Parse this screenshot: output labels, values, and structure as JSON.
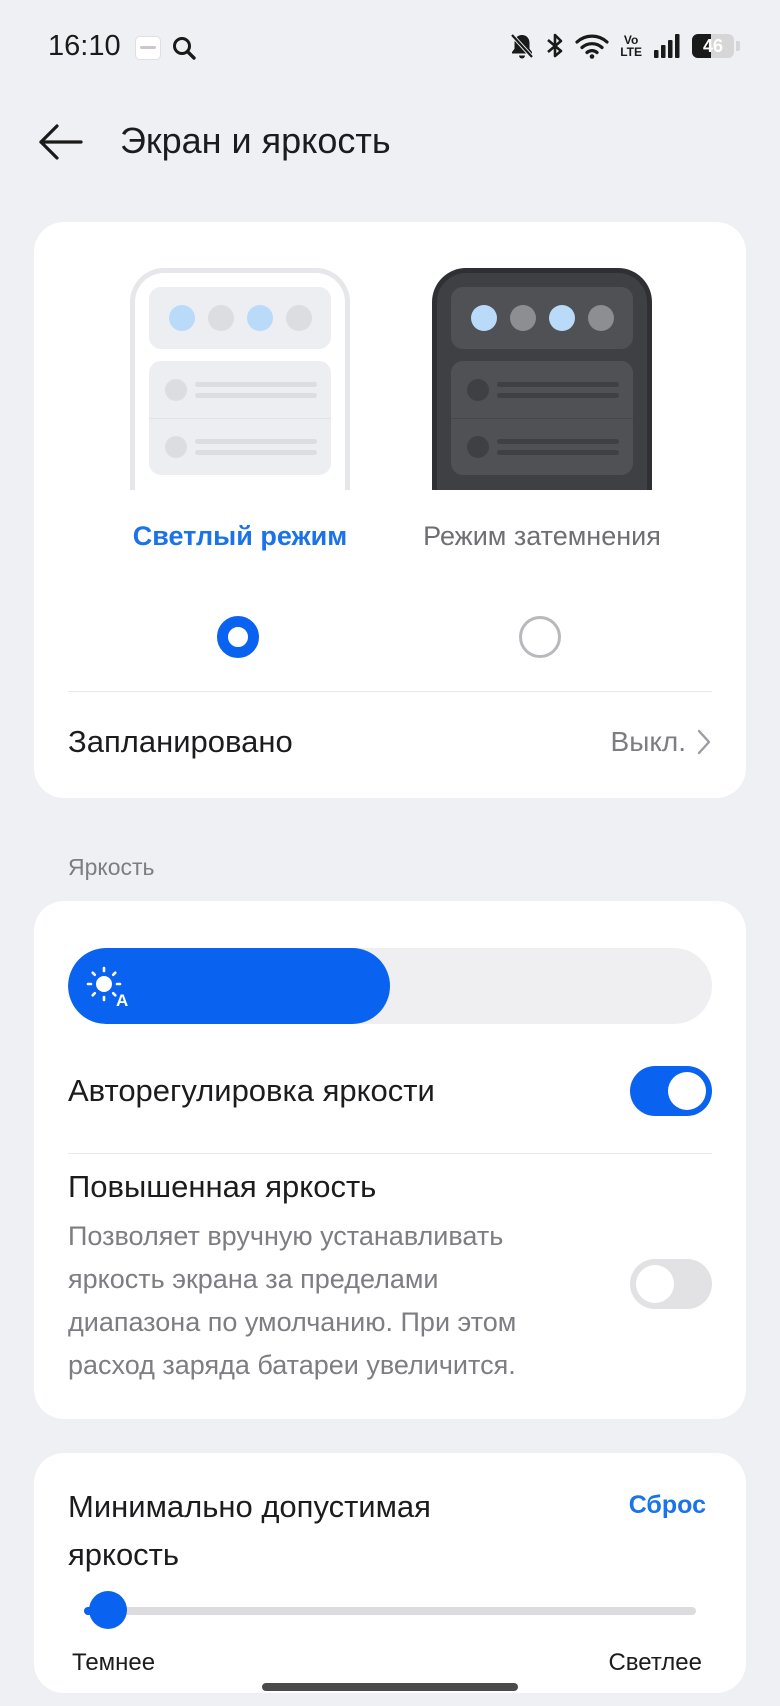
{
  "status_bar": {
    "time": "16:10",
    "icons": [
      "app-notification-icon",
      "search-icon",
      "mute-icon",
      "bluetooth-icon",
      "wifi-icon",
      "volte-icon",
      "signal-icon",
      "battery-icon"
    ],
    "volte_top": "Vo",
    "volte_bottom": "LTE",
    "battery_level": "46"
  },
  "header": {
    "back_icon": "arrow-left-icon",
    "title": "Экран и яркость"
  },
  "theme": {
    "light_label": "Светлый режим",
    "dark_label": "Режим затемнения",
    "selected": "light",
    "scheduled_label": "Запланировано",
    "scheduled_value": "Выкл."
  },
  "brightness": {
    "section_label": "Яркость",
    "level_percent": 50,
    "auto_label": "Авторегулировка яркости",
    "auto_on": true,
    "high_label": "Повышенная яркость",
    "high_desc": "Позволяет вручную устанавливать яркость экрана за пределами диапазона по умолчанию. При этом расход заряда батареи увеличится.",
    "high_on": false
  },
  "min_brightness": {
    "title": "Минимально допустимая яркость",
    "reset_label": "Сброс",
    "left_label": "Темнее",
    "right_label": "Светлее",
    "level_percent": 4
  },
  "colors": {
    "accent": "#0a63f0",
    "link": "#1a73e8",
    "background": "#eff0f3"
  }
}
